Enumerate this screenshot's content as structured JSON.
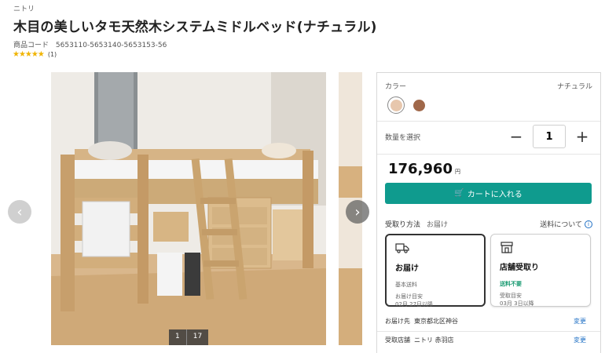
{
  "brand": "ニトリ",
  "title": "木目の美しいタモ天然木システムミドルベッド(ナチュラル)",
  "product_code": {
    "label": "商品コード",
    "value": "5653110-5653140-5653153-56"
  },
  "rating": {
    "stars": 5,
    "count": "(1)"
  },
  "gallery": {
    "current": "1",
    "total": "17"
  },
  "panel": {
    "color_label": "カラー",
    "color_value": "ナチュラル",
    "swatches": [
      {
        "name": "ナチュラル",
        "color": "#e7c7ad",
        "selected": true
      },
      {
        "name": "ブラウン",
        "color": "#a0684a",
        "selected": false
      }
    ],
    "qty_label": "数量を選択",
    "qty_minus": "−",
    "qty_value": "1",
    "qty_plus": "+",
    "price": "176,960",
    "price_unit": "円",
    "cart_label": "カートに入れる",
    "receive_label": "受取り方法",
    "receive_sub": "お届け",
    "shipping_label": "送料について",
    "info_glyph": "i",
    "delivery": {
      "title": "お届け",
      "note": "基本送料",
      "eta_label": "お届け目安",
      "eta_value": "02月 27日以降"
    },
    "store": {
      "title": "店舗受取り",
      "note": "送料不要",
      "eta_label": "受取目安",
      "eta_value": "03月 3日以降"
    },
    "ship_to_label": "お届け先",
    "ship_to_value": "東京都北区神谷",
    "store_label": "受取店舗",
    "store_value": "ニトリ 赤羽店",
    "change_label": "変更"
  },
  "colors": {
    "accent": "#0f9b8e",
    "link": "#1e6fc4",
    "star": "#f0b400",
    "green_note": "#1a9b72"
  }
}
